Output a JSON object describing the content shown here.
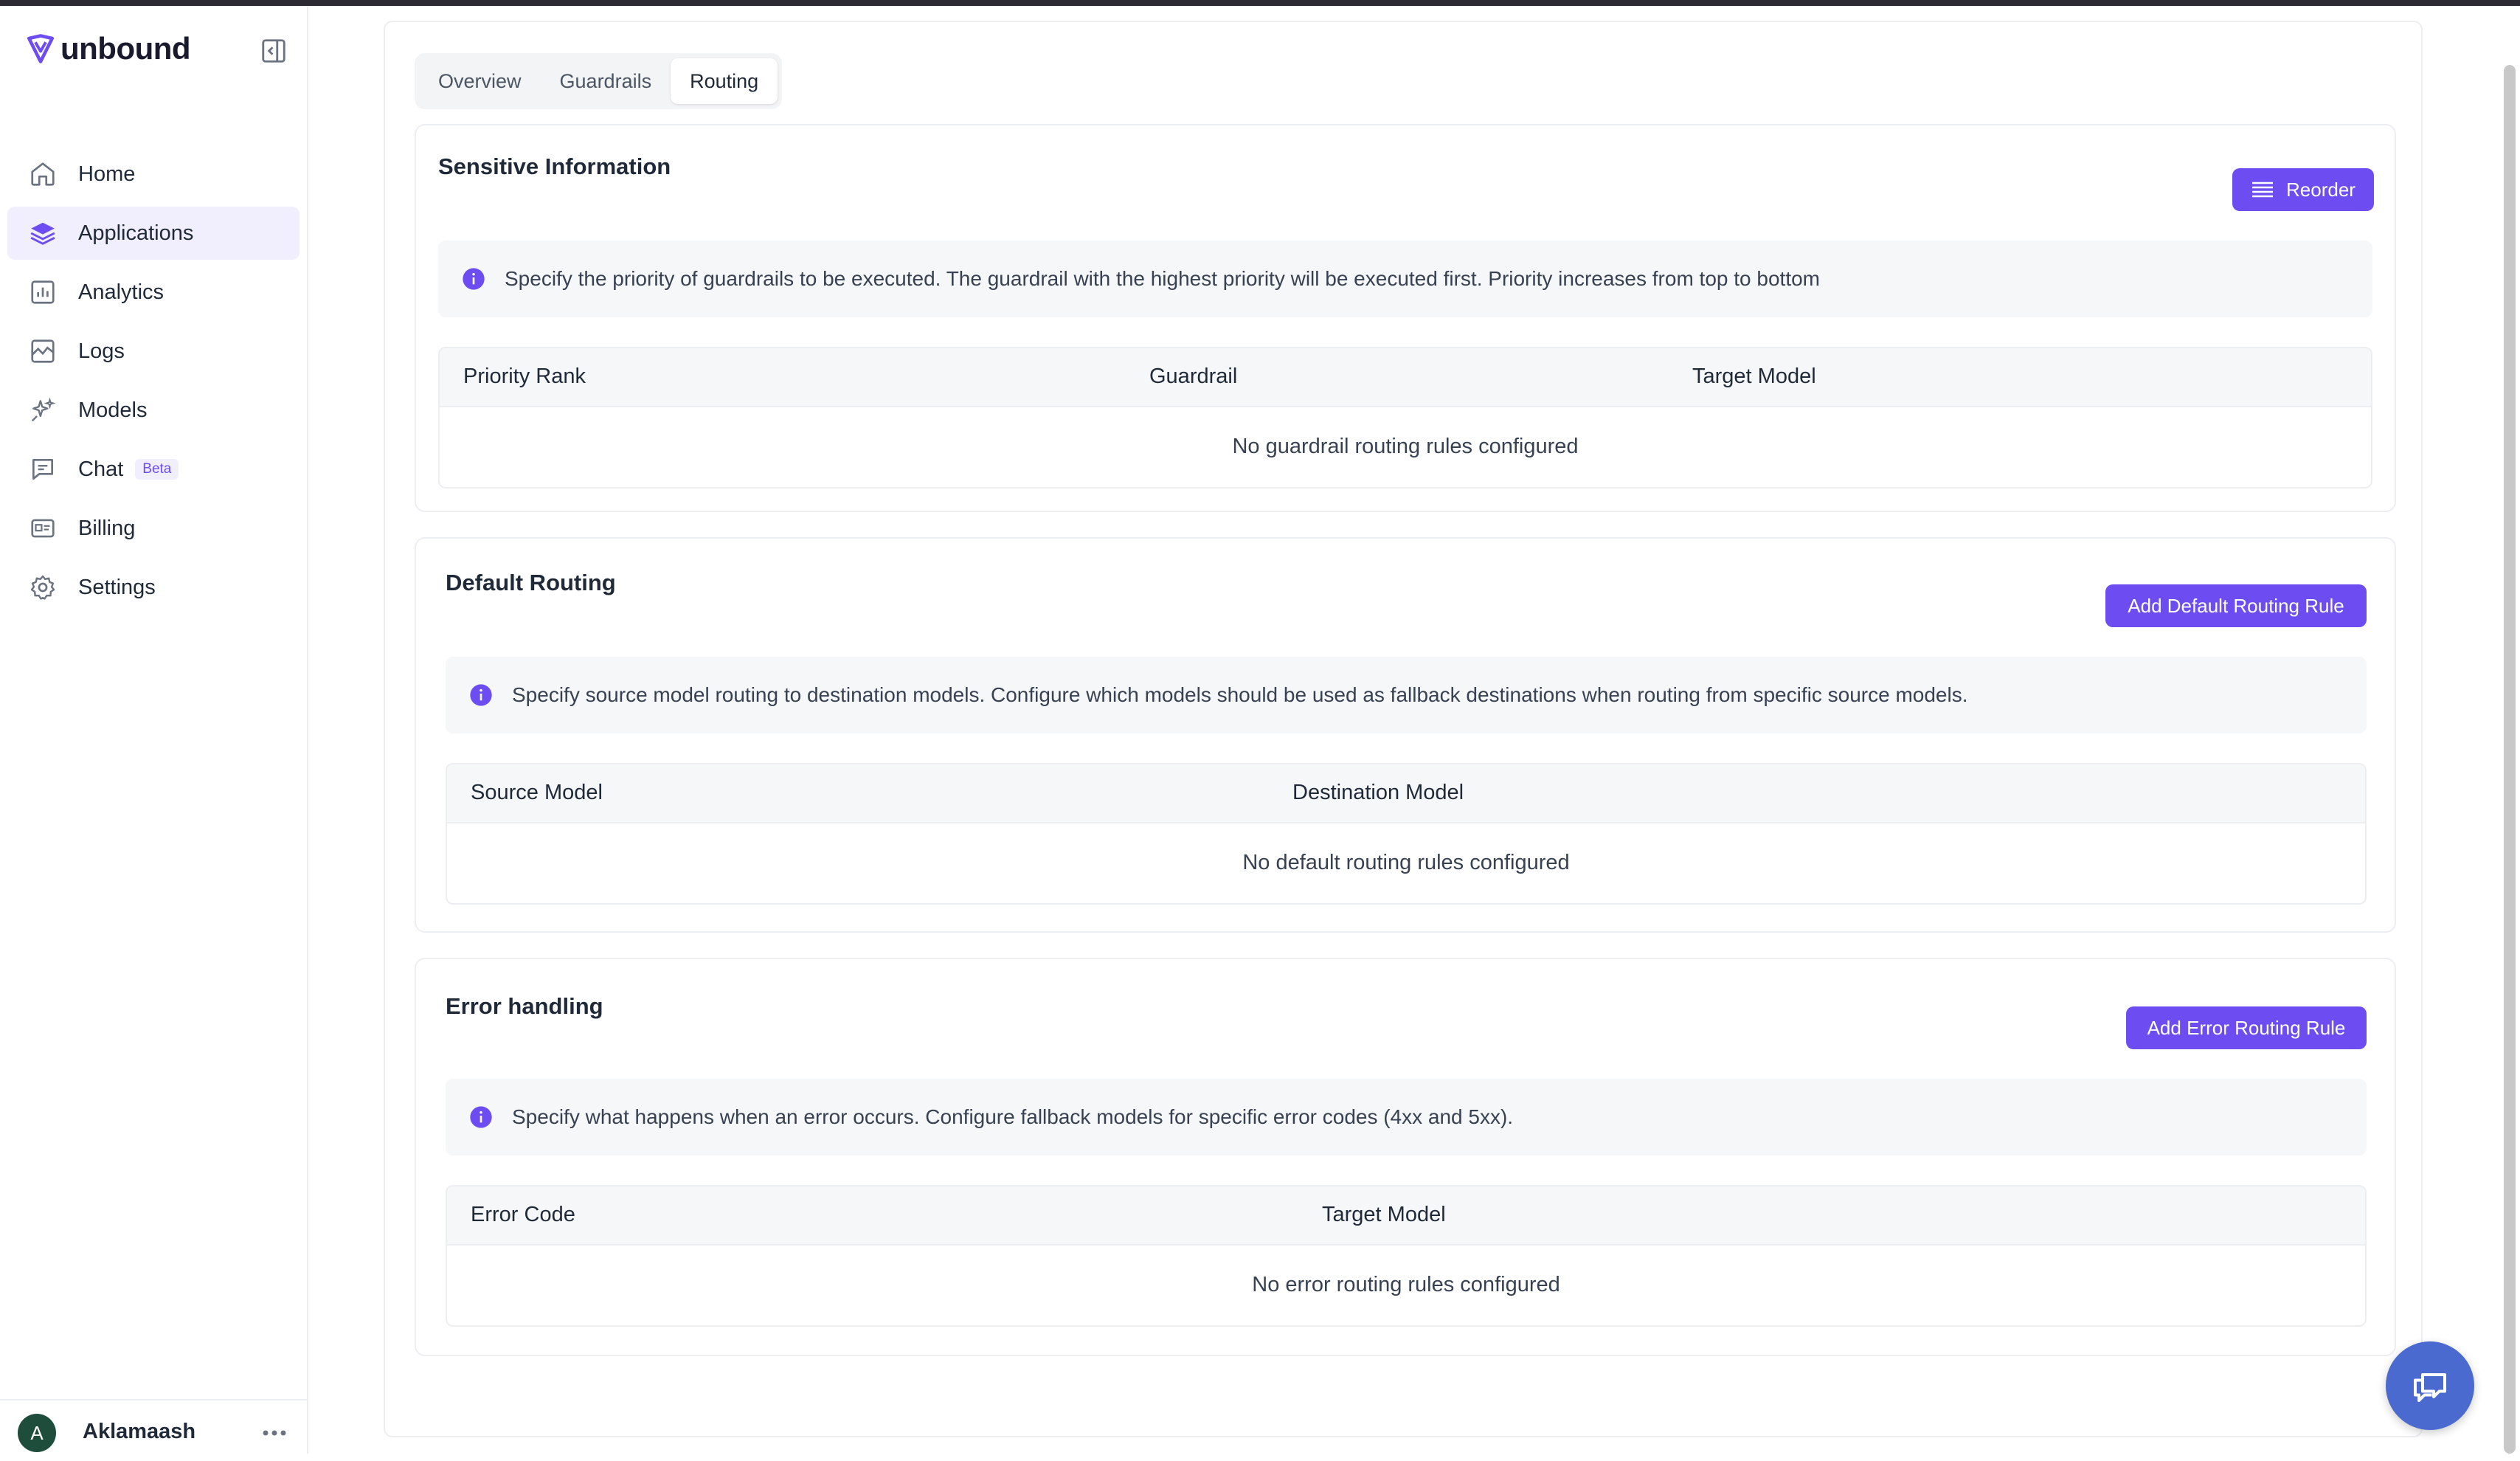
{
  "app": {
    "name": "unbound"
  },
  "sidebar": {
    "items": [
      {
        "label": "Home",
        "icon": "home-icon"
      },
      {
        "label": "Applications",
        "icon": "layers-icon",
        "active": true
      },
      {
        "label": "Analytics",
        "icon": "bar-chart-icon"
      },
      {
        "label": "Logs",
        "icon": "logs-icon"
      },
      {
        "label": "Models",
        "icon": "sparkles-icon"
      },
      {
        "label": "Chat",
        "icon": "chat-icon",
        "badge": "Beta"
      },
      {
        "label": "Billing",
        "icon": "billing-icon"
      },
      {
        "label": "Settings",
        "icon": "gear-icon"
      }
    ]
  },
  "user": {
    "initial": "A",
    "name": "Aklamaash"
  },
  "tabs": [
    {
      "label": "Overview"
    },
    {
      "label": "Guardrails"
    },
    {
      "label": "Routing",
      "active": true
    }
  ],
  "sections": {
    "sensitive": {
      "title": "Sensitive Information",
      "button": "Reorder",
      "info": "Specify the priority of guardrails to be executed. The guardrail with the highest priority will be executed first. Priority increases from top to bottom",
      "columns": [
        "Priority Rank",
        "Guardrail",
        "Target Model"
      ],
      "empty": "No guardrail routing rules configured"
    },
    "default_routing": {
      "title": "Default Routing",
      "button": "Add Default Routing Rule",
      "info": "Specify source model routing to destination models. Configure which models should be used as fallback destinations when routing from specific source models.",
      "columns": [
        "Source Model",
        "Destination Model"
      ],
      "empty": "No default routing rules configured"
    },
    "error_handling": {
      "title": "Error handling",
      "button": "Add Error Routing Rule",
      "info": "Specify what happens when an error occurs. Configure fallback models for specific error codes (4xx and 5xx).",
      "columns": [
        "Error Code",
        "Target Model"
      ],
      "empty": "No error routing rules configured"
    }
  },
  "colors": {
    "accent": "#6d4df2",
    "chat_button": "#4a6ad0"
  }
}
